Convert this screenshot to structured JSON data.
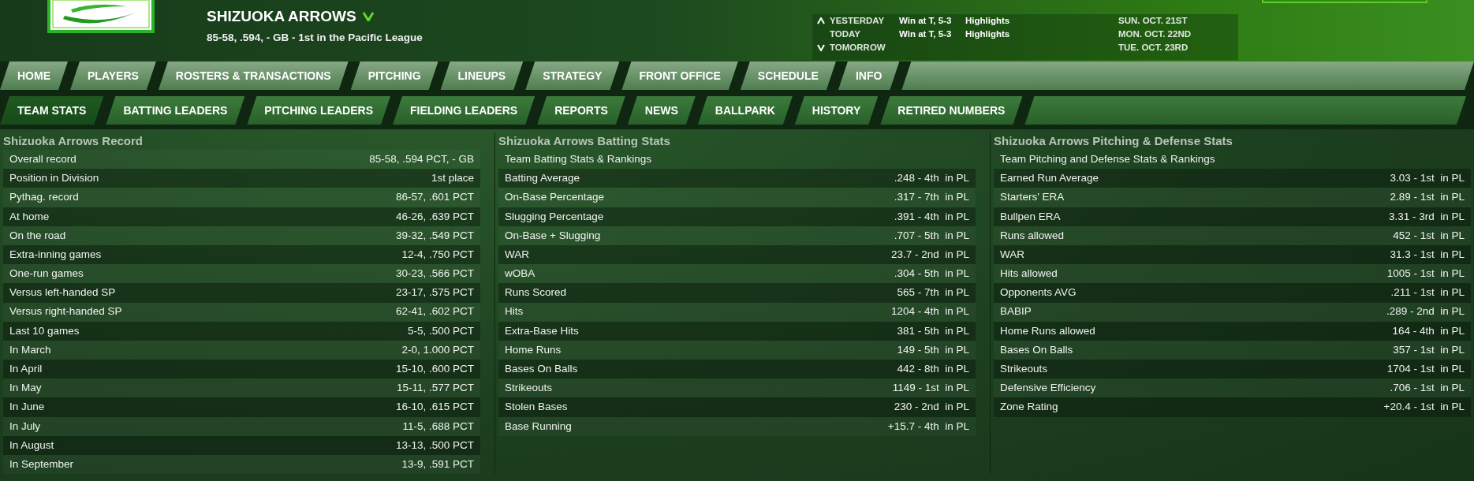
{
  "team": {
    "name": "SHIZUOKA ARROWS",
    "summary": "85-58, .594, - GB - 1st in the Pacific League"
  },
  "schedule": [
    {
      "kind": "past",
      "day": "YESTERDAY",
      "result": "Win at T, 5-3",
      "link": "Highlights",
      "date": "SUN. OCT. 21ST"
    },
    {
      "kind": "today",
      "day": "TODAY",
      "result": "Win at T, 5-3",
      "link": "Highlights",
      "date": "MON. OCT. 22ND"
    },
    {
      "kind": "future",
      "day": "TOMORROW",
      "date": "TUE. OCT. 23RD"
    }
  ],
  "main_nav": [
    {
      "label": "HOME",
      "selected": false
    },
    {
      "label": "PLAYERS",
      "selected": false
    },
    {
      "label": "ROSTERS & TRANSACTIONS",
      "selected": false
    },
    {
      "label": "PITCHING",
      "selected": false
    },
    {
      "label": "LINEUPS",
      "selected": false
    },
    {
      "label": "STRATEGY",
      "selected": false
    },
    {
      "label": "FRONT OFFICE",
      "selected": false
    },
    {
      "label": "SCHEDULE",
      "selected": false
    },
    {
      "label": "INFO",
      "selected": false
    }
  ],
  "sub_nav": [
    {
      "label": "TEAM STATS",
      "selected": true
    },
    {
      "label": "BATTING LEADERS",
      "selected": false
    },
    {
      "label": "PITCHING LEADERS",
      "selected": false
    },
    {
      "label": "FIELDING LEADERS",
      "selected": false
    },
    {
      "label": "REPORTS",
      "selected": false
    },
    {
      "label": "NEWS",
      "selected": false
    },
    {
      "label": "BALLPARK",
      "selected": false
    },
    {
      "label": "HISTORY",
      "selected": false
    },
    {
      "label": "RETIRED NUMBERS",
      "selected": false
    }
  ],
  "panels": [
    {
      "title": "Shizuoka Arrows Record",
      "rows": [
        {
          "label": "Overall record",
          "value": "85-58, .594 PCT, - GB"
        },
        {
          "label": "Position in Division",
          "value": "1st place"
        },
        {
          "label": "Pythag. record",
          "value": "86-57, .601 PCT"
        },
        {
          "label": "At home",
          "value": "46-26, .639 PCT"
        },
        {
          "label": "On the road",
          "value": "39-32, .549 PCT"
        },
        {
          "label": "Extra-inning games",
          "value": "12-4, .750 PCT"
        },
        {
          "label": "One-run games",
          "value": "30-23, .566 PCT"
        },
        {
          "label": "Versus left-handed SP",
          "value": "23-17, .575 PCT"
        },
        {
          "label": "Versus right-handed SP",
          "value": "62-41, .602 PCT"
        },
        {
          "label": "Last 10 games",
          "value": "5-5, .500 PCT"
        },
        {
          "label": "In March",
          "value": "2-0, 1.000 PCT"
        },
        {
          "label": "In April",
          "value": "15-10, .600 PCT"
        },
        {
          "label": "In May",
          "value": "15-11, .577 PCT"
        },
        {
          "label": "In June",
          "value": "16-10, .615 PCT"
        },
        {
          "label": "In July",
          "value": "11-5, .688 PCT"
        },
        {
          "label": "In August",
          "value": "13-13, .500 PCT"
        },
        {
          "label": "In September",
          "value": "13-9, .591 PCT"
        }
      ]
    },
    {
      "title": "Shizuoka Arrows Batting Stats",
      "subtitle": "Team Batting Stats & Rankings",
      "rows": [
        {
          "label": "Batting Average",
          "value": ".248 - 4th  in PL"
        },
        {
          "label": "On-Base Percentage",
          "value": ".317 - 7th  in PL"
        },
        {
          "label": "Slugging Percentage",
          "value": ".391 - 4th  in PL"
        },
        {
          "label": "On-Base + Slugging",
          "value": ".707 - 5th  in PL"
        },
        {
          "label": "WAR",
          "value": "23.7 - 2nd  in PL"
        },
        {
          "label": "wOBA",
          "value": ".304 - 5th  in PL"
        },
        {
          "label": "Runs Scored",
          "value": "565 - 7th  in PL"
        },
        {
          "label": "Hits",
          "value": "1204 - 4th  in PL"
        },
        {
          "label": "Extra-Base Hits",
          "value": "381 - 5th  in PL"
        },
        {
          "label": "Home Runs",
          "value": "149 - 5th  in PL"
        },
        {
          "label": "Bases On Balls",
          "value": "442 - 8th  in PL"
        },
        {
          "label": "Strikeouts",
          "value": "1149 - 1st  in PL"
        },
        {
          "label": "Stolen Bases",
          "value": "230 - 2nd  in PL"
        },
        {
          "label": "Base Running",
          "value": "+15.7 - 4th  in PL"
        }
      ]
    },
    {
      "title": "Shizuoka Arrows Pitching & Defense Stats",
      "subtitle": "Team Pitching and Defense Stats & Rankings",
      "rows": [
        {
          "label": "Earned Run Average",
          "value": "3.03 - 1st  in PL"
        },
        {
          "label": "Starters' ERA",
          "value": "2.89 - 1st  in PL"
        },
        {
          "label": "Bullpen ERA",
          "value": "3.31 - 3rd  in PL"
        },
        {
          "label": "Runs allowed",
          "value": "452 - 1st  in PL"
        },
        {
          "label": "WAR",
          "value": "31.3 - 1st  in PL"
        },
        {
          "label": "Hits allowed",
          "value": "1005 - 1st  in PL"
        },
        {
          "label": "Opponents AVG",
          "value": ".211 - 1st  in PL"
        },
        {
          "label": "BABIP",
          "value": ".289 - 2nd  in PL"
        },
        {
          "label": "Home Runs allowed",
          "value": "164 - 4th  in PL"
        },
        {
          "label": "Bases On Balls",
          "value": "357 - 1st  in PL"
        },
        {
          "label": "Strikeouts",
          "value": "1704 - 1st  in PL"
        },
        {
          "label": "Defensive Efficiency",
          "value": ".706 - 1st  in PL"
        },
        {
          "label": "Zone Rating",
          "value": "+20.4 - 1st  in PL"
        }
      ]
    }
  ]
}
